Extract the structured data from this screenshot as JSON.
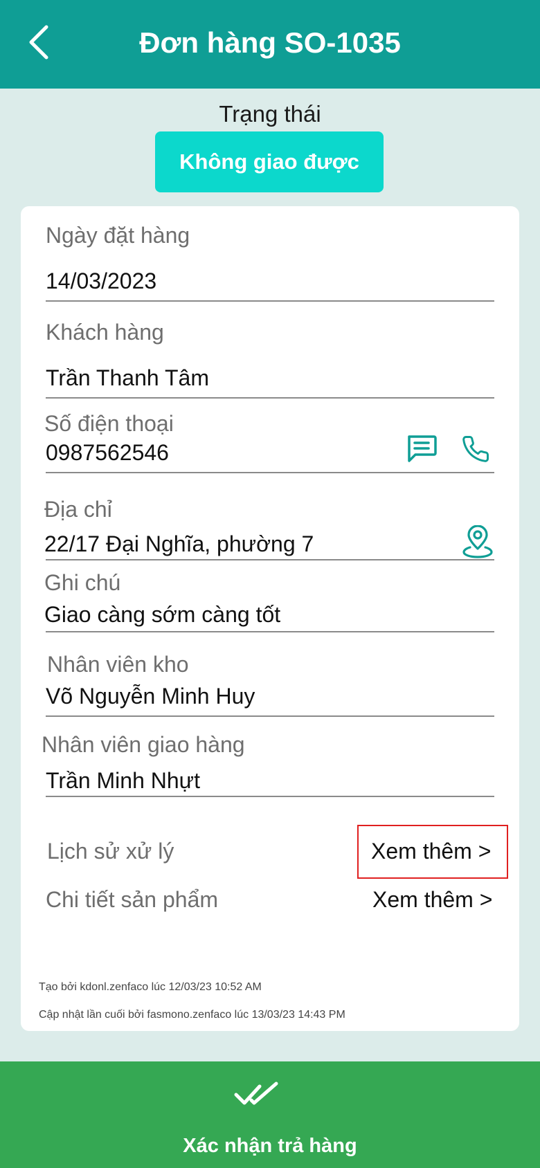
{
  "header": {
    "title": "Đơn hàng SO-1035"
  },
  "status": {
    "label": "Trạng thái",
    "value": "Không giao được"
  },
  "fields": {
    "order_date": {
      "label": "Ngày đặt hàng",
      "value": "14/03/2023"
    },
    "customer": {
      "label": "Khách hàng",
      "value": "Trần Thanh Tâm"
    },
    "phone": {
      "label": "Số điện thoại",
      "value": "0987562546"
    },
    "address": {
      "label": "Địa chỉ",
      "value": "22/17 Đại Nghĩa, phường 7"
    },
    "note": {
      "label": "Ghi chú",
      "value": "Giao càng sớm càng tốt"
    },
    "warehouse_staff": {
      "label": "Nhân viên kho",
      "value": "Võ Nguyễn Minh Huy"
    },
    "delivery_staff": {
      "label": "Nhân viên giao hàng",
      "value": "Trần Minh Nhựt"
    }
  },
  "links": {
    "history": {
      "label": "Lịch sử xử lý",
      "action": "Xem thêm >"
    },
    "products": {
      "label": "Chi tiết sản phẩm",
      "action": "Xem thêm >"
    }
  },
  "meta": {
    "created": "Tạo bởi kdonl.zenfaco lúc 12/03/23 10:52 AM",
    "updated": "Cập nhật lần cuối bởi fasmono.zenfaco lúc 13/03/23 14:43 PM"
  },
  "footer": {
    "confirm_label": "Xác nhận trả hàng"
  },
  "icons": {
    "back": "chevron-left-icon",
    "message": "message-icon",
    "phone": "phone-icon",
    "location": "location-pin-icon",
    "confirm": "double-check-icon"
  },
  "colors": {
    "header": "#0f9e95",
    "status_badge": "#0cd8cc",
    "footer": "#35a853",
    "icon_accent": "#0f9e95",
    "highlight_border": "#e02020"
  }
}
